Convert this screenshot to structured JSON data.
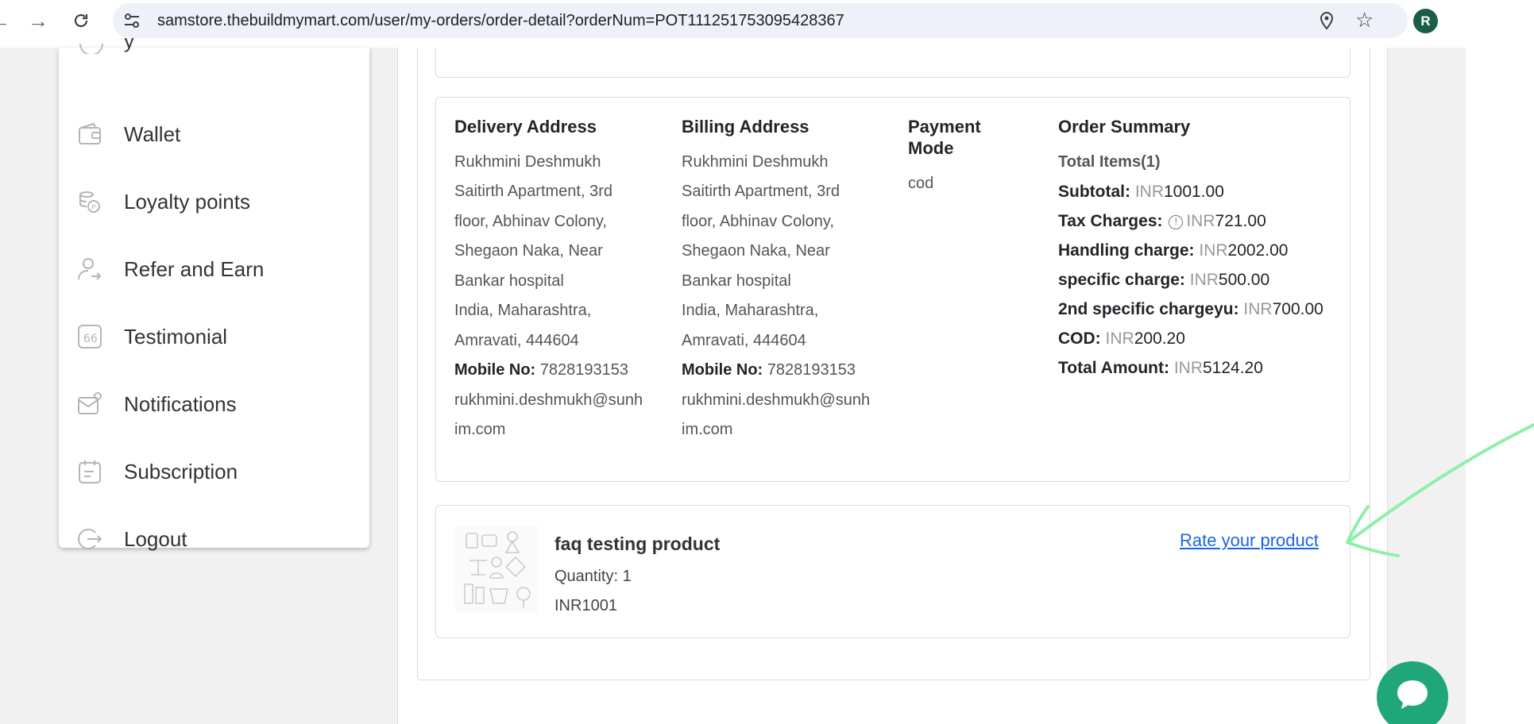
{
  "browser": {
    "url": "samstore.thebuildmymart.com/user/my-orders/order-detail?orderNum=POT111251753095428367",
    "profile_initial": "R"
  },
  "sidebar": {
    "items": [
      {
        "label": "Wallet",
        "icon": "wallet-icon"
      },
      {
        "label": "Loyalty points",
        "icon": "coins-icon"
      },
      {
        "label": "Refer and Earn",
        "icon": "user-share-icon"
      },
      {
        "label": "Testimonial",
        "icon": "quote-icon"
      },
      {
        "label": "Notifications",
        "icon": "mail-notification-icon"
      },
      {
        "label": "Subscription",
        "icon": "calendar-note-icon"
      },
      {
        "label": "Logout",
        "icon": "logout-icon"
      }
    ]
  },
  "order": {
    "delivery": {
      "title": "Delivery Address",
      "lines": [
        "Rukhmini Deshmukh",
        "Saitirth Apartment, 3rd",
        "floor, Abhinav Colony,",
        "Shegaon Naka, Near",
        "Bankar hospital",
        "India, Maharashtra,",
        "Amravati, 444604"
      ],
      "mobile_label": "Mobile No:",
      "mobile": "7828193153",
      "email_line1": "rukhmini.deshmukh@sunh",
      "email_line2": "im.com"
    },
    "billing": {
      "title": "Billing Address",
      "lines": [
        "Rukhmini Deshmukh",
        "Saitirth Apartment, 3rd",
        "floor, Abhinav Colony,",
        "Shegaon Naka, Near",
        "Bankar hospital",
        "India, Maharashtra,",
        "Amravati, 444604"
      ],
      "mobile_label": "Mobile No:",
      "mobile": "7828193153",
      "email_line1": "rukhmini.deshmukh@sunh",
      "email_line2": "im.com"
    },
    "payment": {
      "title_line1": "Payment",
      "title_line2": "Mode",
      "value": "cod"
    },
    "summary": {
      "title": "Order Summary",
      "total_items": "Total Items(1)",
      "currency": "INR",
      "rows": [
        {
          "label": "Subtotal:",
          "value": "1001.00"
        },
        {
          "label": "Tax Charges:",
          "value": "721.00"
        },
        {
          "label": "Handling charge:",
          "value": "2002.00"
        },
        {
          "label": "specific charge:",
          "value": "500.00"
        },
        {
          "label": "2nd specific chargeyu:",
          "value": "700.00"
        },
        {
          "label": "COD:",
          "value": "200.20"
        },
        {
          "label": "Total Amount:",
          "value": "5124.20"
        }
      ]
    },
    "product": {
      "name": "faq testing product",
      "quantity": "Quantity: 1",
      "price": "INR1001",
      "rate_link": "Rate your product"
    }
  },
  "colors": {
    "link": "#1a66e0",
    "chat": "#1fa77a",
    "annotation": "#8ef0a8",
    "avatar": "#1b5e47"
  }
}
